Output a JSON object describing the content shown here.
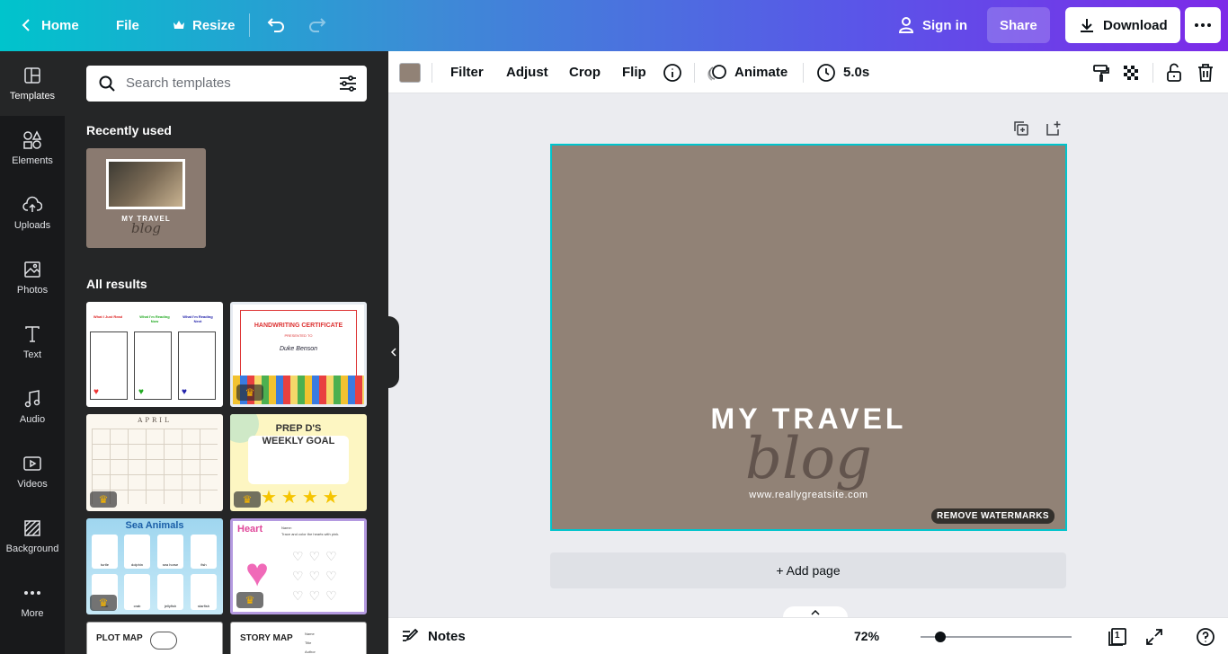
{
  "topbar": {
    "home_label": "Home",
    "file_label": "File",
    "resize_label": "Resize",
    "signin_label": "Sign in",
    "share_label": "Share",
    "download_label": "Download"
  },
  "rail": {
    "items": [
      {
        "label": "Templates",
        "icon": "templates-icon"
      },
      {
        "label": "Elements",
        "icon": "elements-icon"
      },
      {
        "label": "Uploads",
        "icon": "uploads-icon"
      },
      {
        "label": "Photos",
        "icon": "photos-icon"
      },
      {
        "label": "Text",
        "icon": "text-icon"
      },
      {
        "label": "Audio",
        "icon": "audio-icon"
      },
      {
        "label": "Videos",
        "icon": "videos-icon"
      },
      {
        "label": "Background",
        "icon": "background-icon"
      },
      {
        "label": "More",
        "icon": "more-icon"
      }
    ]
  },
  "panel": {
    "search_placeholder": "Search templates",
    "recent_title": "Recently used",
    "recent_thumb": {
      "title": "MY TRAVEL",
      "script": "blog"
    },
    "results_title": "All results",
    "templates": [
      {
        "name": "reading-chart",
        "col1": "What I Just Read",
        "col2": "What I'm Reading Now",
        "col3": "What I'm Reading Next"
      },
      {
        "name": "handwriting-certificate",
        "title": "HANDWRITING CERTIFICATE",
        "sub": "PRESENTED TO",
        "person": "Duke Benson",
        "premium": true
      },
      {
        "name": "april-calendar",
        "title": "APRIL",
        "premium": true
      },
      {
        "name": "weekly-goal",
        "title1": "PREP D'S",
        "title2": "WEEKLY GOAL",
        "premium": true
      },
      {
        "name": "sea-animals",
        "title": "Sea Animals",
        "animals": [
          "turtle",
          "dolphin",
          "sea horse",
          "fish",
          "crab",
          "crab",
          "jellyfish",
          "starfish"
        ],
        "premium": true
      },
      {
        "name": "heart-tracing",
        "title": "Heart",
        "name_label": "Name:",
        "instruction": "Trace and color the hearts with pink.",
        "premium": true
      },
      {
        "name": "plot-map",
        "title": "PLOT MAP"
      },
      {
        "name": "story-map",
        "title": "STORY MAP",
        "fields": [
          "Name",
          "Title",
          "Author"
        ]
      }
    ]
  },
  "toolbar": {
    "color_swatch": "#918276",
    "filter_label": "Filter",
    "adjust_label": "Adjust",
    "crop_label": "Crop",
    "flip_label": "Flip",
    "animate_label": "Animate",
    "duration_label": "5.0s"
  },
  "canvas": {
    "background": "#918276",
    "title": "MY TRAVEL",
    "script": "blog",
    "url": "www.reallygreatsite.com",
    "watermark": "REMOVE WATERMARKS"
  },
  "add_page_label": "+ Add page",
  "bottombar": {
    "notes_label": "Notes",
    "zoom_label": "72%",
    "page_count": "1"
  }
}
